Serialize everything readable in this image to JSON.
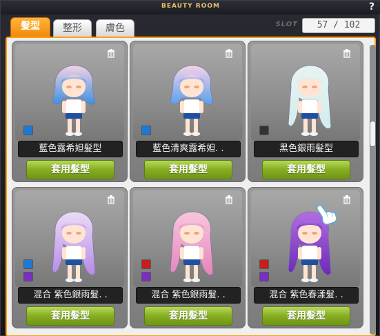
{
  "window": {
    "title": "BEAUTY ROOM",
    "help_label": "?"
  },
  "tabs": [
    {
      "label": "髮型",
      "active": true
    },
    {
      "label": "整形",
      "active": false
    },
    {
      "label": "膚色",
      "active": false
    }
  ],
  "slot": {
    "label": "SLOT",
    "value": "57 / 102"
  },
  "cards": [
    {
      "name": "藍色露希妲髮型",
      "button": "套用髮型",
      "swatches": [
        "#1c7ad6"
      ],
      "hair_top": "#f2d3e4",
      "hair_bottom": "#3f8fe0"
    },
    {
      "name": "藍色清爽露希妲. .",
      "button": "套用髮型",
      "swatches": [
        "#1c7ad6"
      ],
      "hair_top": "#f6d2e6",
      "hair_bottom": "#5aa0ef"
    },
    {
      "name": "黑色銀雨髮型",
      "button": "套用髮型",
      "swatches": [
        "#333333"
      ],
      "hair_top": "#e6f4f3",
      "hair_bottom": "#d4ecec"
    },
    {
      "name": "混合 紫色銀雨髮. .",
      "button": "套用髮型",
      "swatches": [
        "#1c7ad6",
        "#7a2fc2"
      ],
      "hair_top": "#eadbf5",
      "hair_bottom": "#b78ae8"
    },
    {
      "name": "混合 紫色銀雨髮. .",
      "button": "套用髮型",
      "swatches": [
        "#c81e1e",
        "#7a2fc2"
      ],
      "hair_top": "#f7c6dc",
      "hair_bottom": "#e585bd"
    },
    {
      "name": "混合 紫色春漾髮. .",
      "button": "套用髮型",
      "swatches": [
        "#c81e1e",
        "#7a2fc2"
      ],
      "hair_top": "#b26de2",
      "hair_bottom": "#6a2bb5"
    }
  ],
  "colors": {
    "accent": "#ff9f12",
    "apply_button": "#86ad22"
  }
}
